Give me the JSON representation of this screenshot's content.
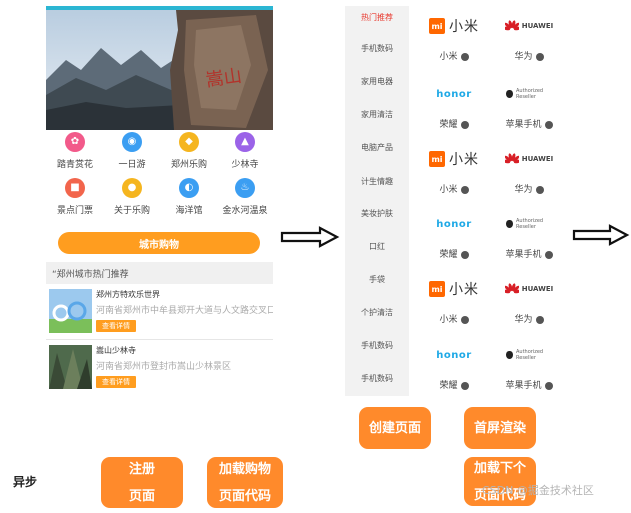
{
  "phone1": {
    "icons": [
      {
        "label": "踏青赏花",
        "color": "#f25a8a",
        "icon": "flower-icon",
        "glyph": "✿"
      },
      {
        "label": "一日游",
        "color": "#3b9ef2",
        "icon": "car-icon",
        "glyph": "◉"
      },
      {
        "label": "郑州乐购",
        "color": "#f5b51f",
        "icon": "shopping-icon",
        "glyph": "◆"
      },
      {
        "label": "少林寺",
        "color": "#9b63e8",
        "icon": "temple-icon",
        "glyph": "▲"
      },
      {
        "label": "景点门票",
        "color": "#f2654c",
        "icon": "ticket-icon",
        "glyph": "■"
      },
      {
        "label": "关于乐购",
        "color": "#f5b51f",
        "icon": "info-icon",
        "glyph": "●"
      },
      {
        "label": "海洋馆",
        "color": "#3b9ef2",
        "icon": "ocean-icon",
        "glyph": "◐"
      },
      {
        "label": "金水河温泉",
        "color": "#3b9ef2",
        "icon": "hot-spring-icon",
        "glyph": "♨"
      }
    ],
    "city_button": "城市购物",
    "section_title": "“郑州城市热门推荐",
    "attractions": [
      {
        "title": "郑州方特欢乐世界",
        "address": "河南省郑州市中牟县郑开大道与人文路交叉口",
        "button": "查看详情"
      },
      {
        "title": "嵩山少林寺",
        "address": "河南省郑州市登封市嵩山少林景区",
        "button": "查看详情"
      }
    ]
  },
  "phone2": {
    "categories": [
      "热门推荐",
      "手机数码",
      "家用电器",
      "家用清洁",
      "电脑产品",
      "计生情趣",
      "美妆护肤",
      "口红",
      "手袋",
      "个护清洁",
      "手机数码",
      "手机数码"
    ],
    "brands": [
      {
        "name": "小米",
        "logo": "xiaomi"
      },
      {
        "name": "华为",
        "logo": "huawei"
      },
      {
        "name": "荣耀",
        "logo": "honor"
      },
      {
        "name": "苹果手机",
        "logo": "apple"
      },
      {
        "name": "小米",
        "logo": "xiaomi"
      },
      {
        "name": "华为",
        "logo": "huawei"
      },
      {
        "name": "荣耀",
        "logo": "honor"
      },
      {
        "name": "苹果手机",
        "logo": "apple"
      },
      {
        "name": "小米",
        "logo": "xiaomi"
      },
      {
        "name": "华为",
        "logo": "huawei"
      },
      {
        "name": "荣耀",
        "logo": "honor"
      },
      {
        "name": "苹果手机",
        "logo": "apple"
      }
    ],
    "logo_text": {
      "mi_mark": "mi",
      "mi_word": "小米",
      "huawei": "HUAWEI",
      "honor": "honor",
      "apple": "Authorized Reseller"
    }
  },
  "buttons": {
    "create_page": "创建页面",
    "first_screen": "首屏渲染",
    "register_page": "注册\n页面",
    "load_shopping": "加载购物\n页面代码",
    "load_next": "加载下个\n页面代码"
  },
  "async_label": "异步",
  "watermark": "CSDN @掘金技术社区",
  "colors": {
    "accent_orange": "#ff8a2b",
    "banner_teal": "#2bb6d3",
    "active_red": "#e8372c"
  }
}
